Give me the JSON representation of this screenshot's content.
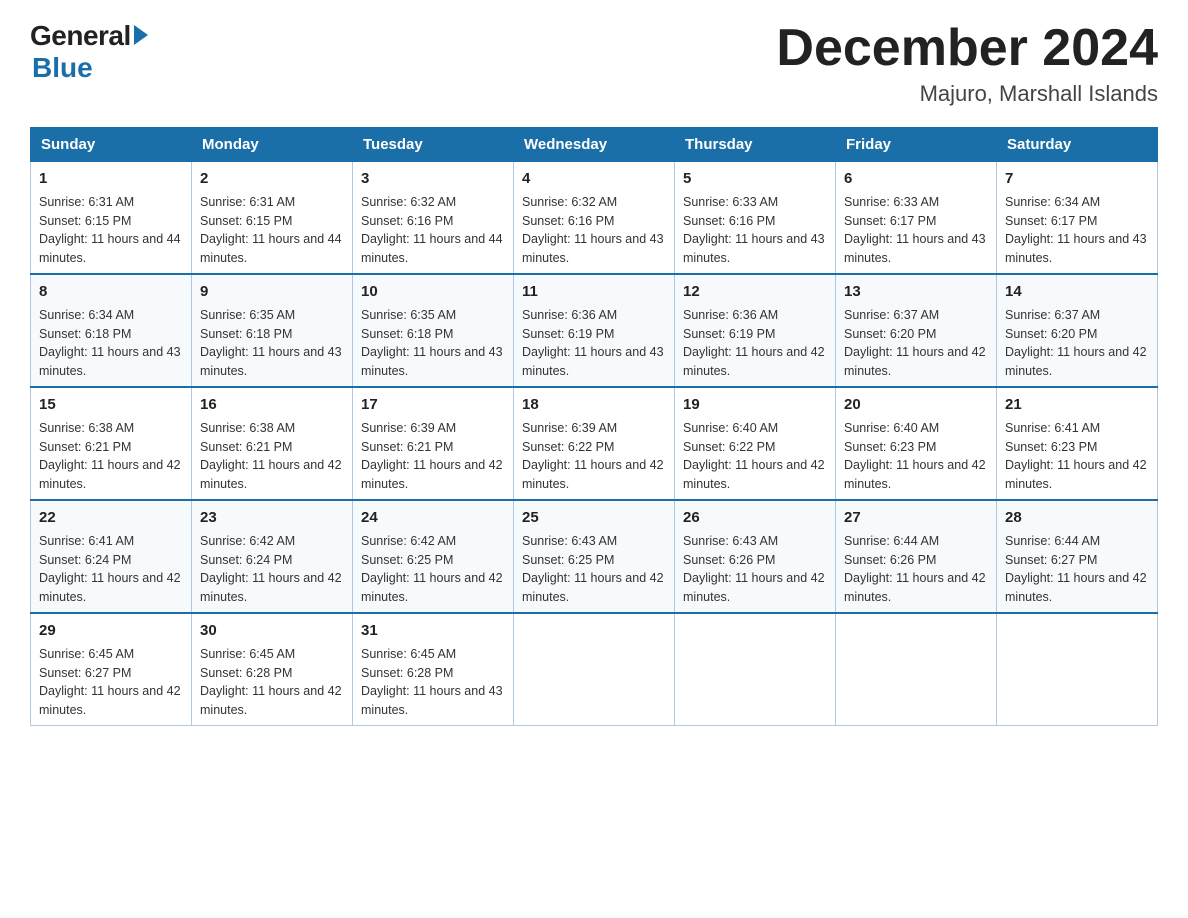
{
  "header": {
    "logo_general": "General",
    "logo_blue": "Blue",
    "month_title": "December 2024",
    "location": "Majuro, Marshall Islands"
  },
  "weekdays": [
    "Sunday",
    "Monday",
    "Tuesday",
    "Wednesday",
    "Thursday",
    "Friday",
    "Saturday"
  ],
  "weeks": [
    [
      {
        "day": "1",
        "sunrise": "6:31 AM",
        "sunset": "6:15 PM",
        "daylight": "11 hours and 44 minutes."
      },
      {
        "day": "2",
        "sunrise": "6:31 AM",
        "sunset": "6:15 PM",
        "daylight": "11 hours and 44 minutes."
      },
      {
        "day": "3",
        "sunrise": "6:32 AM",
        "sunset": "6:16 PM",
        "daylight": "11 hours and 44 minutes."
      },
      {
        "day": "4",
        "sunrise": "6:32 AM",
        "sunset": "6:16 PM",
        "daylight": "11 hours and 43 minutes."
      },
      {
        "day": "5",
        "sunrise": "6:33 AM",
        "sunset": "6:16 PM",
        "daylight": "11 hours and 43 minutes."
      },
      {
        "day": "6",
        "sunrise": "6:33 AM",
        "sunset": "6:17 PM",
        "daylight": "11 hours and 43 minutes."
      },
      {
        "day": "7",
        "sunrise": "6:34 AM",
        "sunset": "6:17 PM",
        "daylight": "11 hours and 43 minutes."
      }
    ],
    [
      {
        "day": "8",
        "sunrise": "6:34 AM",
        "sunset": "6:18 PM",
        "daylight": "11 hours and 43 minutes."
      },
      {
        "day": "9",
        "sunrise": "6:35 AM",
        "sunset": "6:18 PM",
        "daylight": "11 hours and 43 minutes."
      },
      {
        "day": "10",
        "sunrise": "6:35 AM",
        "sunset": "6:18 PM",
        "daylight": "11 hours and 43 minutes."
      },
      {
        "day": "11",
        "sunrise": "6:36 AM",
        "sunset": "6:19 PM",
        "daylight": "11 hours and 43 minutes."
      },
      {
        "day": "12",
        "sunrise": "6:36 AM",
        "sunset": "6:19 PM",
        "daylight": "11 hours and 42 minutes."
      },
      {
        "day": "13",
        "sunrise": "6:37 AM",
        "sunset": "6:20 PM",
        "daylight": "11 hours and 42 minutes."
      },
      {
        "day": "14",
        "sunrise": "6:37 AM",
        "sunset": "6:20 PM",
        "daylight": "11 hours and 42 minutes."
      }
    ],
    [
      {
        "day": "15",
        "sunrise": "6:38 AM",
        "sunset": "6:21 PM",
        "daylight": "11 hours and 42 minutes."
      },
      {
        "day": "16",
        "sunrise": "6:38 AM",
        "sunset": "6:21 PM",
        "daylight": "11 hours and 42 minutes."
      },
      {
        "day": "17",
        "sunrise": "6:39 AM",
        "sunset": "6:21 PM",
        "daylight": "11 hours and 42 minutes."
      },
      {
        "day": "18",
        "sunrise": "6:39 AM",
        "sunset": "6:22 PM",
        "daylight": "11 hours and 42 minutes."
      },
      {
        "day": "19",
        "sunrise": "6:40 AM",
        "sunset": "6:22 PM",
        "daylight": "11 hours and 42 minutes."
      },
      {
        "day": "20",
        "sunrise": "6:40 AM",
        "sunset": "6:23 PM",
        "daylight": "11 hours and 42 minutes."
      },
      {
        "day": "21",
        "sunrise": "6:41 AM",
        "sunset": "6:23 PM",
        "daylight": "11 hours and 42 minutes."
      }
    ],
    [
      {
        "day": "22",
        "sunrise": "6:41 AM",
        "sunset": "6:24 PM",
        "daylight": "11 hours and 42 minutes."
      },
      {
        "day": "23",
        "sunrise": "6:42 AM",
        "sunset": "6:24 PM",
        "daylight": "11 hours and 42 minutes."
      },
      {
        "day": "24",
        "sunrise": "6:42 AM",
        "sunset": "6:25 PM",
        "daylight": "11 hours and 42 minutes."
      },
      {
        "day": "25",
        "sunrise": "6:43 AM",
        "sunset": "6:25 PM",
        "daylight": "11 hours and 42 minutes."
      },
      {
        "day": "26",
        "sunrise": "6:43 AM",
        "sunset": "6:26 PM",
        "daylight": "11 hours and 42 minutes."
      },
      {
        "day": "27",
        "sunrise": "6:44 AM",
        "sunset": "6:26 PM",
        "daylight": "11 hours and 42 minutes."
      },
      {
        "day": "28",
        "sunrise": "6:44 AM",
        "sunset": "6:27 PM",
        "daylight": "11 hours and 42 minutes."
      }
    ],
    [
      {
        "day": "29",
        "sunrise": "6:45 AM",
        "sunset": "6:27 PM",
        "daylight": "11 hours and 42 minutes."
      },
      {
        "day": "30",
        "sunrise": "6:45 AM",
        "sunset": "6:28 PM",
        "daylight": "11 hours and 42 minutes."
      },
      {
        "day": "31",
        "sunrise": "6:45 AM",
        "sunset": "6:28 PM",
        "daylight": "11 hours and 43 minutes."
      },
      null,
      null,
      null,
      null
    ]
  ],
  "labels": {
    "sunrise": "Sunrise:",
    "sunset": "Sunset:",
    "daylight": "Daylight:"
  }
}
